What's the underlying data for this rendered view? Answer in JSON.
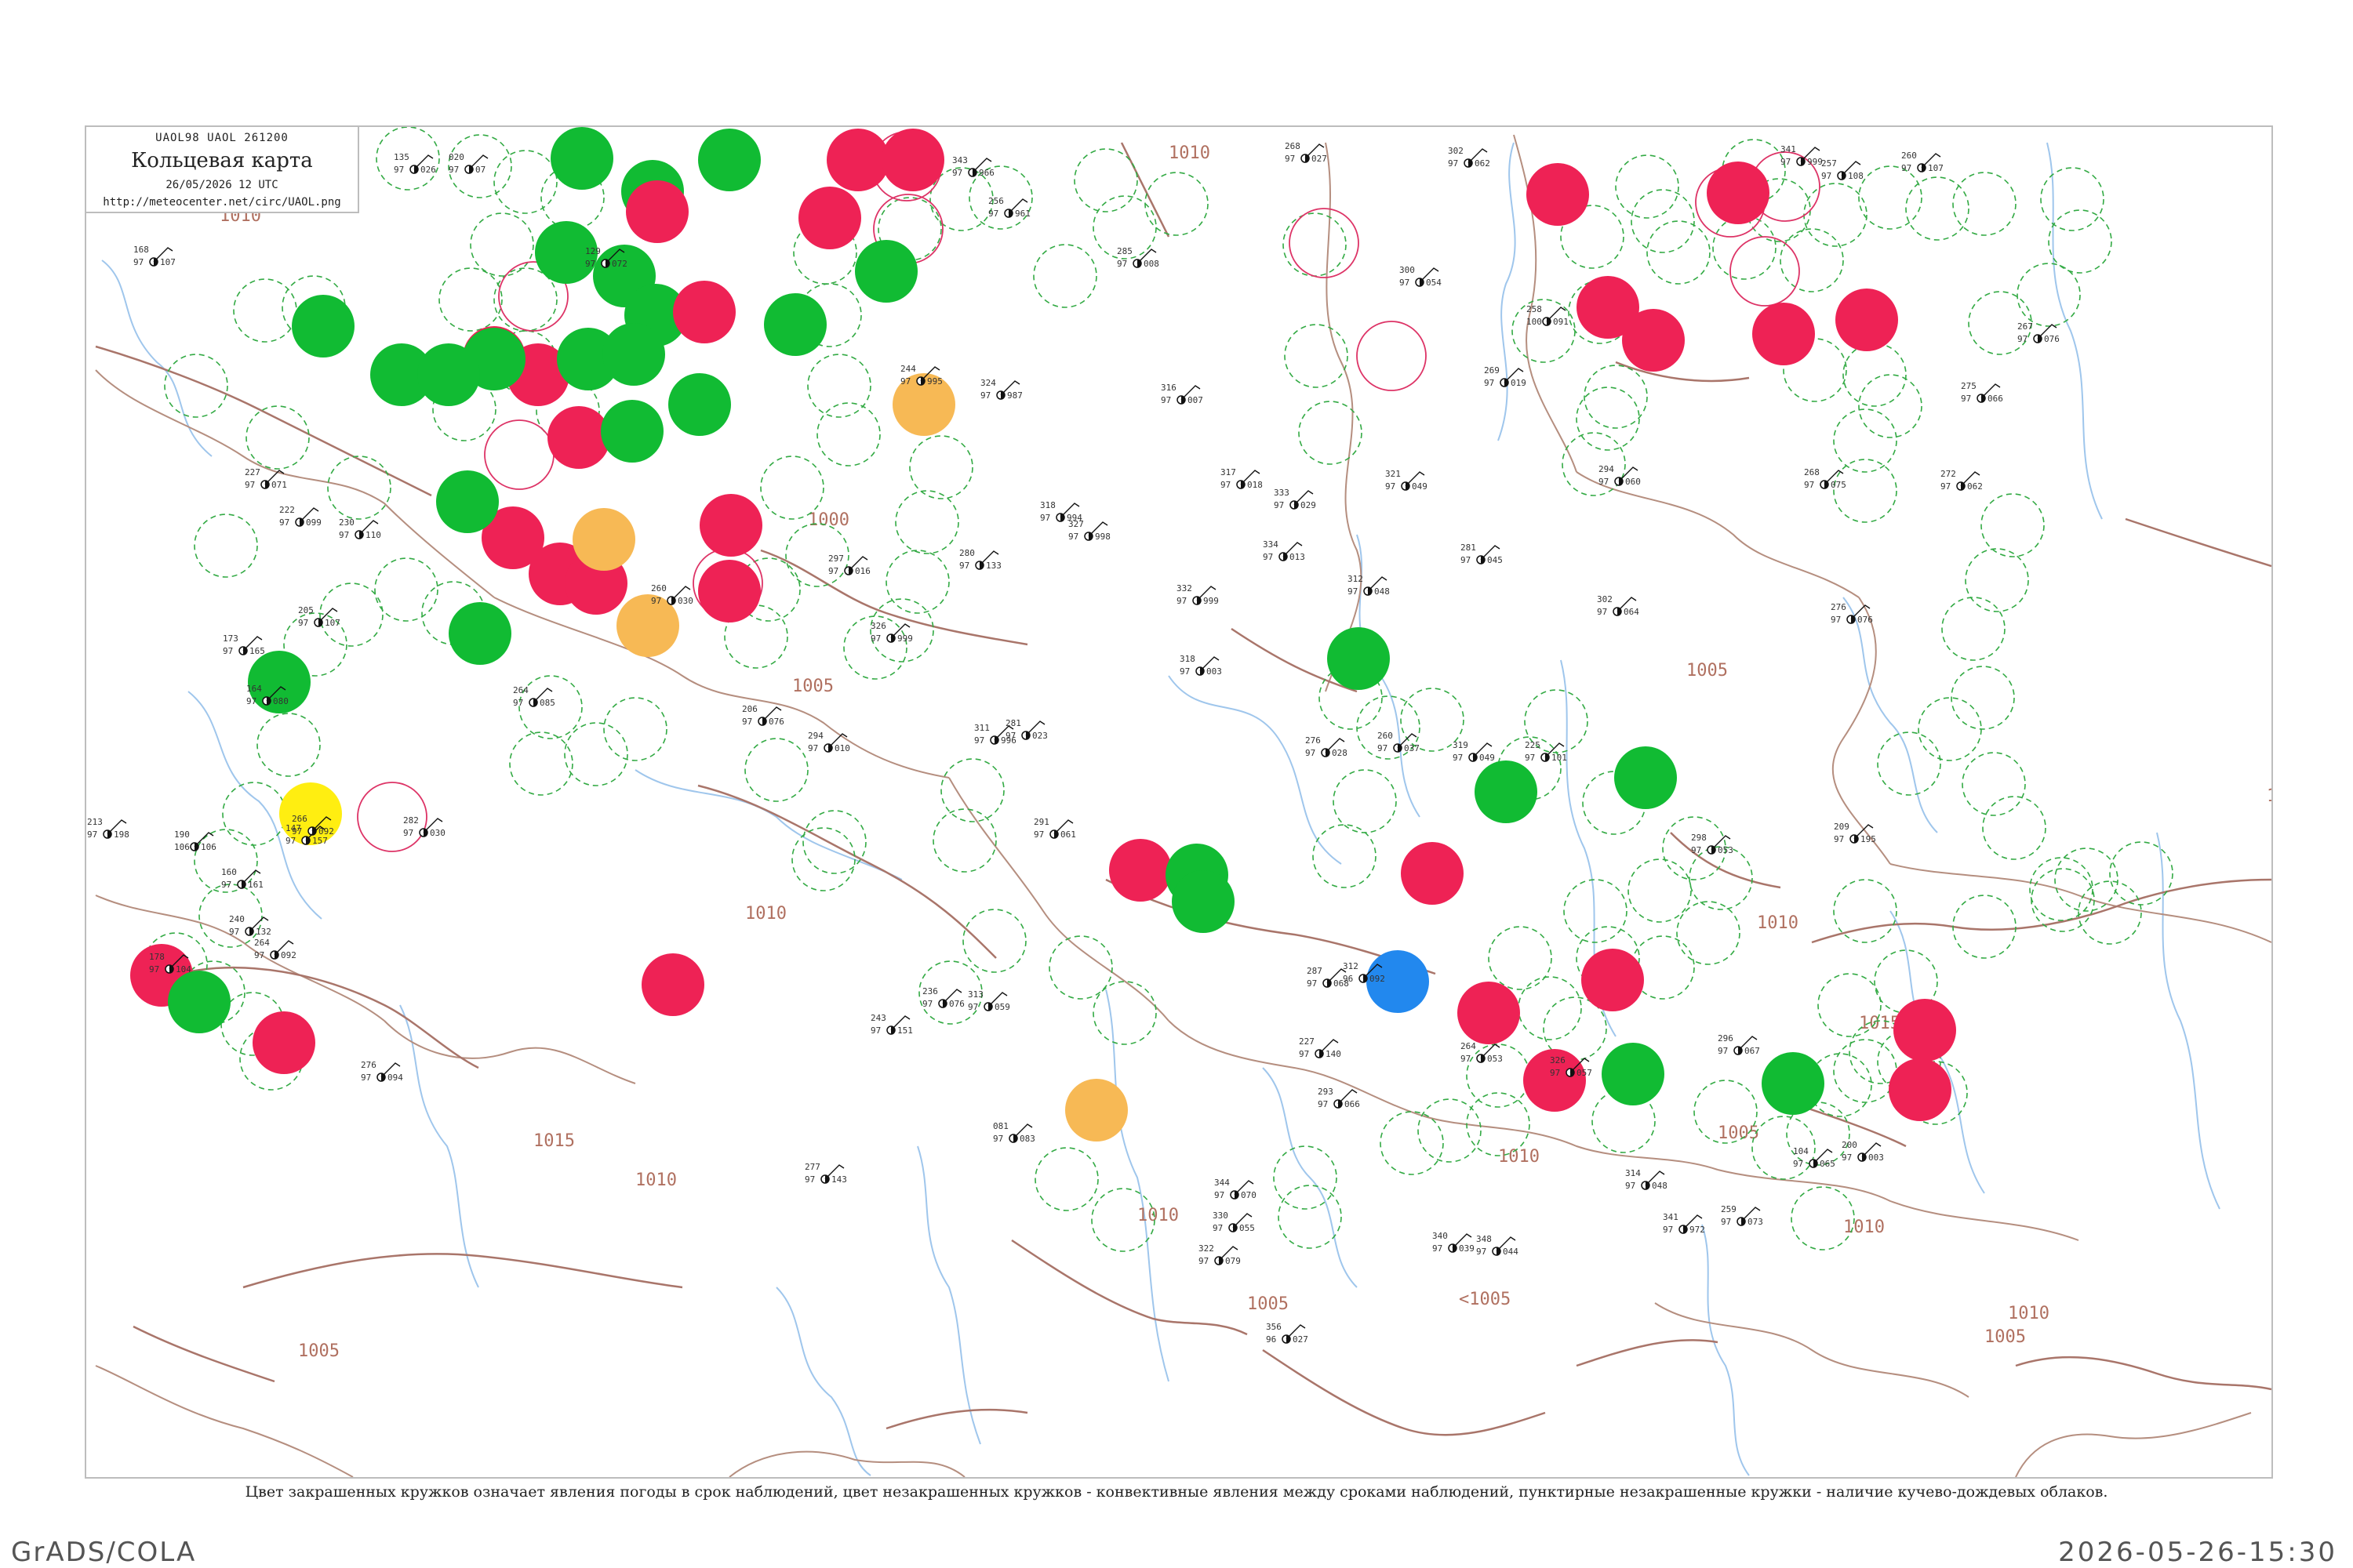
{
  "header": {
    "codes": "UAOL98  UAOL  261200",
    "title": "Кольцевая карта",
    "date": "26/05/2026 12 UTC",
    "url": "http://meteocenter.net/circ/UAOL.png"
  },
  "caption": "Цвет закрашенных кружков означает явления погоды в срок наблюдений, цвет незакрашенных кружков - конвективные явления между сроками наблюдений, пунктирные незакрашенные кружки - наличие кучево-дождевых облаков.",
  "footer": {
    "left": "GrADS/COLA",
    "right": "2026-05-26-15:30"
  },
  "colors": {
    "green": "#11bb33",
    "red": "#ee2255",
    "orange": "#f7b955",
    "yellow": "#ffee11",
    "blue": "#2288ee",
    "ring_red": "#dd3366",
    "ring_green": "#33aa44",
    "isobar": "#a9756a",
    "river": "#9fc6ec"
  },
  "isobar_labels": [
    "1010",
    "1015",
    "1005",
    "1000",
    "1010",
    "1005",
    "1010",
    "1010",
    "1015",
    "1005",
    "1010",
    "1005",
    "1010",
    "1005",
    "1010",
    "<1005",
    "1010",
    "1005",
    "1010",
    "1010"
  ],
  "stations": [
    {
      "p": "168",
      "t": "97",
      "d": "107"
    },
    {
      "p": "135",
      "t": "97",
      "d": "026"
    },
    {
      "p": "020",
      "t": "97",
      "d": "07"
    },
    {
      "p": "129",
      "t": "97",
      "d": "072"
    },
    {
      "p": "343",
      "t": "97",
      "d": "966"
    },
    {
      "p": "256",
      "t": "97",
      "d": "961"
    },
    {
      "p": "268",
      "t": "97",
      "d": "027"
    },
    {
      "p": "302",
      "t": "97",
      "d": "062"
    },
    {
      "p": "341",
      "t": "97",
      "d": "999"
    },
    {
      "p": "260",
      "t": "97",
      "d": "107"
    },
    {
      "p": "257",
      "t": "97",
      "d": "108"
    },
    {
      "p": "285",
      "t": "97",
      "d": "008"
    },
    {
      "p": "300",
      "t": "97",
      "d": "054"
    },
    {
      "p": "258",
      "t": "100",
      "d": "091"
    },
    {
      "p": "269",
      "t": "97",
      "d": "019"
    },
    {
      "p": "227",
      "t": "97",
      "d": "071"
    },
    {
      "p": "222",
      "t": "97",
      "d": "099"
    },
    {
      "p": "244",
      "t": "97",
      "d": "995"
    },
    {
      "p": "324",
      "t": "97",
      "d": "987"
    },
    {
      "p": "318",
      "t": "97",
      "d": "994"
    },
    {
      "p": "327",
      "t": "97",
      "d": "998"
    },
    {
      "p": "316",
      "t": "97",
      "d": "007"
    },
    {
      "p": "317",
      "t": "97",
      "d": "018"
    },
    {
      "p": "333",
      "t": "97",
      "d": "029"
    },
    {
      "p": "321",
      "t": "97",
      "d": "049"
    },
    {
      "p": "281",
      "t": "97",
      "d": "045"
    },
    {
      "p": "294",
      "t": "97",
      "d": "060"
    },
    {
      "p": "268",
      "t": "97",
      "d": "075"
    },
    {
      "p": "272",
      "t": "97",
      "d": "062"
    },
    {
      "p": "280",
      "t": "97",
      "d": "133"
    },
    {
      "p": "230",
      "t": "97",
      "d": "110"
    },
    {
      "p": "205",
      "t": "97",
      "d": "107"
    },
    {
      "p": "173",
      "t": "97",
      "d": "165"
    },
    {
      "p": "297",
      "t": "97",
      "d": "016"
    },
    {
      "p": "260",
      "t": "97",
      "d": "030"
    },
    {
      "p": "326",
      "t": "97",
      "d": "999"
    },
    {
      "p": "332",
      "t": "97",
      "d": "999"
    },
    {
      "p": "318",
      "t": "97",
      "d": "003"
    },
    {
      "p": "334",
      "t": "97",
      "d": "013"
    },
    {
      "p": "312",
      "t": "97",
      "d": "048"
    },
    {
      "p": "302",
      "t": "97",
      "d": "064"
    },
    {
      "p": "276",
      "t": "97",
      "d": "076"
    },
    {
      "p": "164",
      "t": "97",
      "d": "080"
    },
    {
      "p": "264",
      "t": "97",
      "d": "085"
    },
    {
      "p": "206",
      "t": "97",
      "d": "076"
    },
    {
      "p": "294",
      "t": "97",
      "d": "010"
    },
    {
      "p": "311",
      "t": "97",
      "d": "996"
    },
    {
      "p": "281",
      "t": "97",
      "d": "023"
    },
    {
      "p": "276",
      "t": "97",
      "d": "028"
    },
    {
      "p": "260",
      "t": "97",
      "d": "037"
    },
    {
      "p": "319",
      "t": "97",
      "d": "049"
    },
    {
      "p": "225",
      "t": "97",
      "d": "101"
    },
    {
      "p": "213",
      "t": "97",
      "d": "198"
    },
    {
      "p": "190",
      "t": "106",
      "d": "106"
    },
    {
      "p": "266",
      "t": "97",
      "d": "092"
    },
    {
      "p": "282",
      "t": "97",
      "d": "030"
    },
    {
      "p": "291",
      "t": "97",
      "d": "061"
    },
    {
      "p": "298",
      "t": "97",
      "d": "053"
    },
    {
      "p": "209",
      "t": "97",
      "d": "195"
    },
    {
      "p": "147",
      "t": "97",
      "d": "157"
    },
    {
      "p": "160",
      "t": "97",
      "d": "161"
    },
    {
      "p": "240",
      "t": "97",
      "d": "132"
    },
    {
      "p": "178",
      "t": "97",
      "d": "104"
    },
    {
      "p": "264",
      "t": "97",
      "d": "092"
    },
    {
      "p": "236",
      "t": "97",
      "d": "076"
    },
    {
      "p": "313",
      "t": "97",
      "d": "059"
    },
    {
      "p": "287",
      "t": "97",
      "d": "068"
    },
    {
      "p": "227",
      "t": "97",
      "d": "140"
    },
    {
      "p": "243",
      "t": "97",
      "d": "151"
    },
    {
      "p": "276",
      "t": "97",
      "d": "094"
    },
    {
      "p": "312",
      "t": "96",
      "d": "092"
    },
    {
      "p": "293",
      "t": "97",
      "d": "066"
    },
    {
      "p": "264",
      "t": "97",
      "d": "053"
    },
    {
      "p": "326",
      "t": "97",
      "d": "057"
    },
    {
      "p": "296",
      "t": "97",
      "d": "067"
    },
    {
      "p": "277",
      "t": "97",
      "d": "143"
    },
    {
      "p": "081",
      "t": "97",
      "d": "083"
    },
    {
      "p": "322",
      "t": "97",
      "d": "079"
    },
    {
      "p": "344",
      "t": "97",
      "d": "070"
    },
    {
      "p": "330",
      "t": "97",
      "d": "055"
    },
    {
      "p": "340",
      "t": "97",
      "d": "039"
    },
    {
      "p": "348",
      "t": "97",
      "d": "044"
    },
    {
      "p": "314",
      "t": "97",
      "d": "048"
    },
    {
      "p": "341",
      "t": "97",
      "d": "972"
    },
    {
      "p": "259",
      "t": "97",
      "d": "073"
    },
    {
      "p": "104",
      "t": "97",
      "d": "065"
    },
    {
      "p": "200",
      "t": "97",
      "d": "003"
    },
    {
      "p": "356",
      "t": "96",
      "d": "027"
    },
    {
      "p": "275",
      "t": "97",
      "d": "066"
    },
    {
      "p": "267",
      "t": "97",
      "d": "076"
    }
  ]
}
